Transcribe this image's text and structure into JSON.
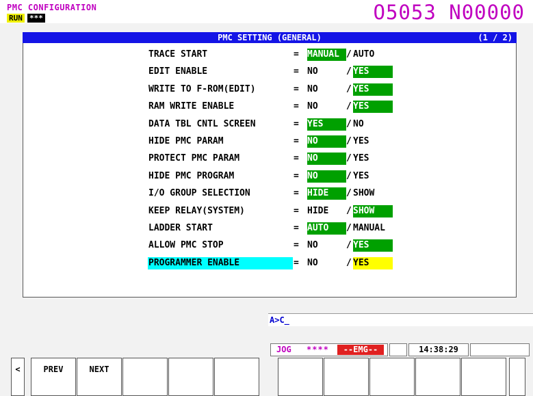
{
  "header": {
    "screen_title": "PMC CONFIGURATION",
    "run_status": "RUN",
    "alarm_status": "***",
    "program_number": "O5053 N00000"
  },
  "panel": {
    "title": "PMC SETTING (GENERAL)",
    "page": "(1 / 2)",
    "rows": [
      {
        "label": "TRACE START",
        "eq": "=",
        "opt1": "MANUAL",
        "sep": "/",
        "opt2": "AUTO",
        "selected": 1,
        "focused": false
      },
      {
        "label": "EDIT ENABLE",
        "eq": "=",
        "opt1": "NO",
        "sep": "/",
        "opt2": "YES",
        "selected": 2,
        "focused": false
      },
      {
        "label": "WRITE TO F-ROM(EDIT)",
        "eq": "=",
        "opt1": "NO",
        "sep": "/",
        "opt2": "YES",
        "selected": 2,
        "focused": false
      },
      {
        "label": "RAM WRITE ENABLE",
        "eq": "=",
        "opt1": "NO",
        "sep": "/",
        "opt2": "YES",
        "selected": 2,
        "focused": false
      },
      {
        "label": "DATA TBL CNTL SCREEN",
        "eq": "=",
        "opt1": "YES",
        "sep": "/",
        "opt2": "NO",
        "selected": 1,
        "focused": false
      },
      {
        "label": "HIDE PMC PARAM",
        "eq": "=",
        "opt1": "NO",
        "sep": "/",
        "opt2": "YES",
        "selected": 1,
        "focused": false
      },
      {
        "label": "PROTECT PMC PARAM",
        "eq": "=",
        "opt1": "NO",
        "sep": "/",
        "opt2": "YES",
        "selected": 1,
        "focused": false
      },
      {
        "label": "HIDE PMC PROGRAM",
        "eq": "=",
        "opt1": "NO",
        "sep": "/",
        "opt2": "YES",
        "selected": 1,
        "focused": false
      },
      {
        "label": "I/O GROUP SELECTION",
        "eq": "=",
        "opt1": "HIDE",
        "sep": "/",
        "opt2": "SHOW",
        "selected": 1,
        "focused": false
      },
      {
        "label": "KEEP RELAY(SYSTEM)",
        "eq": "=",
        "opt1": "HIDE",
        "sep": "/",
        "opt2": "SHOW",
        "selected": 2,
        "focused": false
      },
      {
        "label": "LADDER START",
        "eq": "=",
        "opt1": "AUTO",
        "sep": "/",
        "opt2": "MANUAL",
        "selected": 1,
        "focused": false
      },
      {
        "label": "ALLOW PMC STOP",
        "eq": "=",
        "opt1": "NO",
        "sep": "/",
        "opt2": "YES",
        "selected": 2,
        "focused": false
      },
      {
        "label": "PROGRAMMER ENABLE",
        "eq": "=",
        "opt1": "NO",
        "sep": "/",
        "opt2": "YES",
        "selected": 2,
        "focused": true
      }
    ]
  },
  "input_line": "A>C_",
  "mode_status": {
    "mode": "JOG",
    "stars": "****",
    "emg": "--EMG--",
    "time": "14:38:29"
  },
  "softkeys": {
    "left_arrow": "<",
    "keys": [
      "PREV",
      "NEXT",
      "",
      "",
      "",
      "",
      "",
      "",
      "",
      "",
      ""
    ]
  },
  "colors": {
    "selected_bg": "#00a000",
    "focus_label_bg": "#00ffff",
    "focus_value_bg": "#ffff00",
    "header_bar": "#1414e6",
    "title_magenta": "#c000c0"
  }
}
